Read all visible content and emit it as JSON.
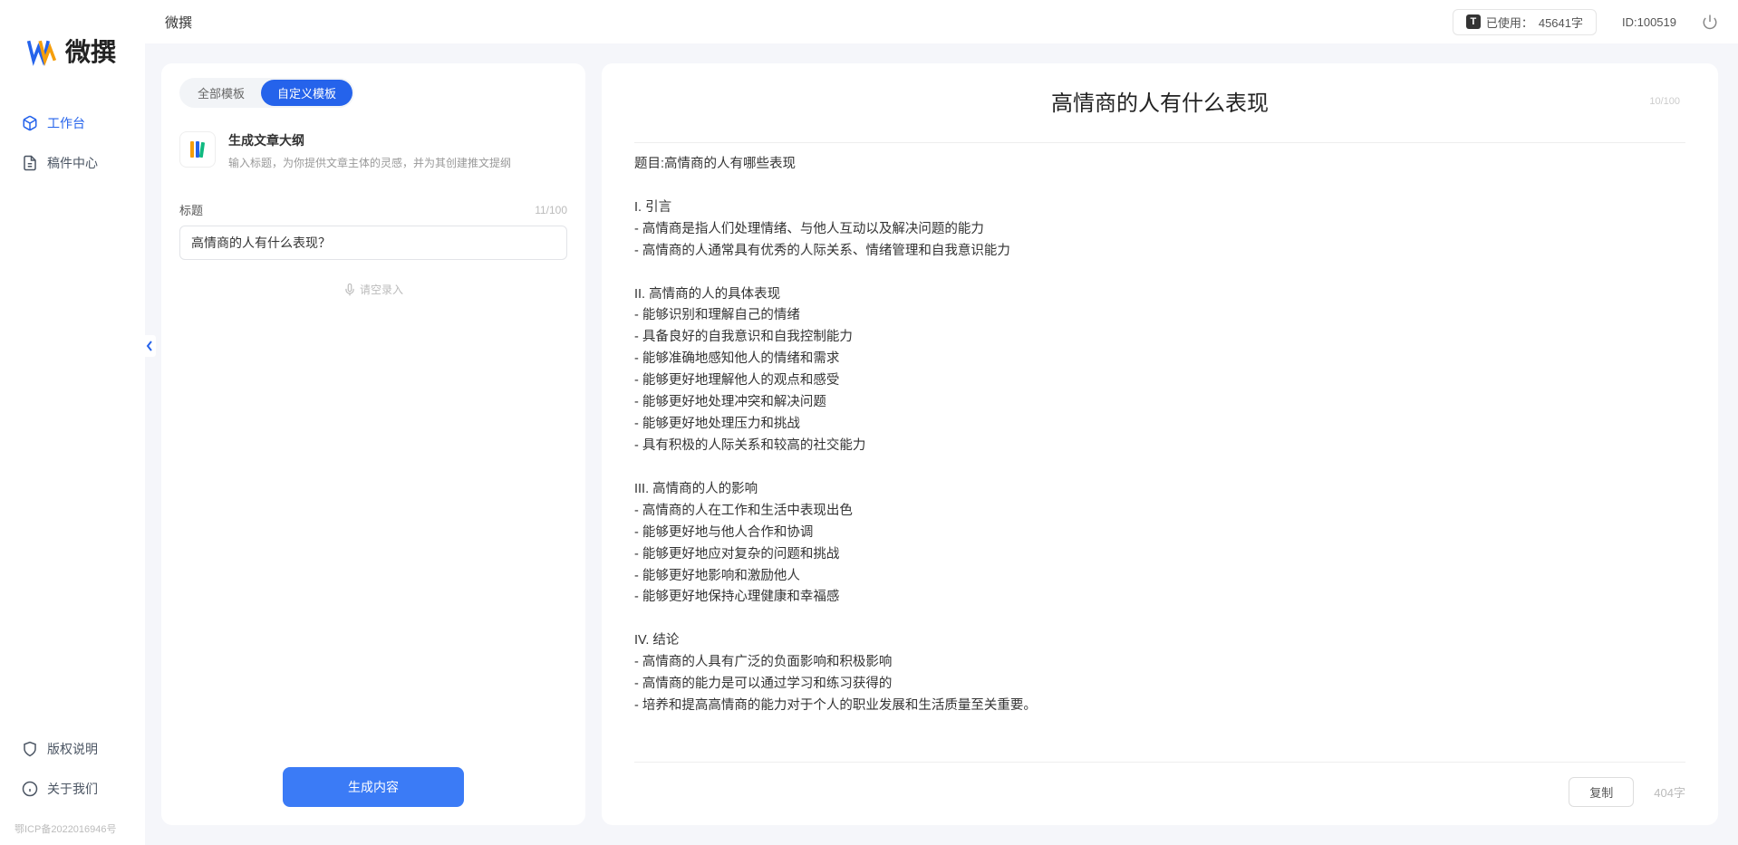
{
  "app": {
    "name": "微撰",
    "logo_text": "微撰"
  },
  "sidebar": {
    "nav": [
      {
        "label": "工作台",
        "icon": "cube"
      },
      {
        "label": "稿件中心",
        "icon": "document"
      }
    ],
    "footer": [
      {
        "label": "版权说明",
        "icon": "shield"
      },
      {
        "label": "关于我们",
        "icon": "info"
      }
    ],
    "icp": "鄂ICP备2022016946号"
  },
  "topbar": {
    "title": "微撰",
    "usage_prefix": "已使用：",
    "usage_value": "45641字",
    "user_id": "ID:100519"
  },
  "leftPanel": {
    "tabs": [
      {
        "label": "全部模板"
      },
      {
        "label": "自定义模板"
      }
    ],
    "template": {
      "title": "生成文章大纲",
      "desc": "输入标题，为你提供文章主体的灵感，并为其创建推文提纲"
    },
    "form": {
      "label": "标题",
      "count": "11/100",
      "value": "高情商的人有什么表现？",
      "voice_hint": "请空录入"
    },
    "button": "生成内容"
  },
  "rightPanel": {
    "title": "高情商的人有什么表现",
    "title_count": "10/100",
    "body": "题目:高情商的人有哪些表现\n\nI. 引言\n- 高情商是指人们处理情绪、与他人互动以及解决问题的能力\n- 高情商的人通常具有优秀的人际关系、情绪管理和自我意识能力\n\nII. 高情商的人的具体表现\n- 能够识别和理解自己的情绪\n- 具备良好的自我意识和自我控制能力\n- 能够准确地感知他人的情绪和需求\n- 能够更好地理解他人的观点和感受\n- 能够更好地处理冲突和解决问题\n- 能够更好地处理压力和挑战\n- 具有积极的人际关系和较高的社交能力\n\nIII. 高情商的人的影响\n- 高情商的人在工作和生活中表现出色\n- 能够更好地与他人合作和协调\n- 能够更好地应对复杂的问题和挑战\n- 能够更好地影响和激励他人\n- 能够更好地保持心理健康和幸福感\n\nIV. 结论\n- 高情商的人具有广泛的负面影响和积极影响\n- 高情商的能力是可以通过学习和练习获得的\n- 培养和提高高情商的能力对于个人的职业发展和生活质量至关重要。",
    "copy": "复制",
    "word_count": "404字"
  }
}
